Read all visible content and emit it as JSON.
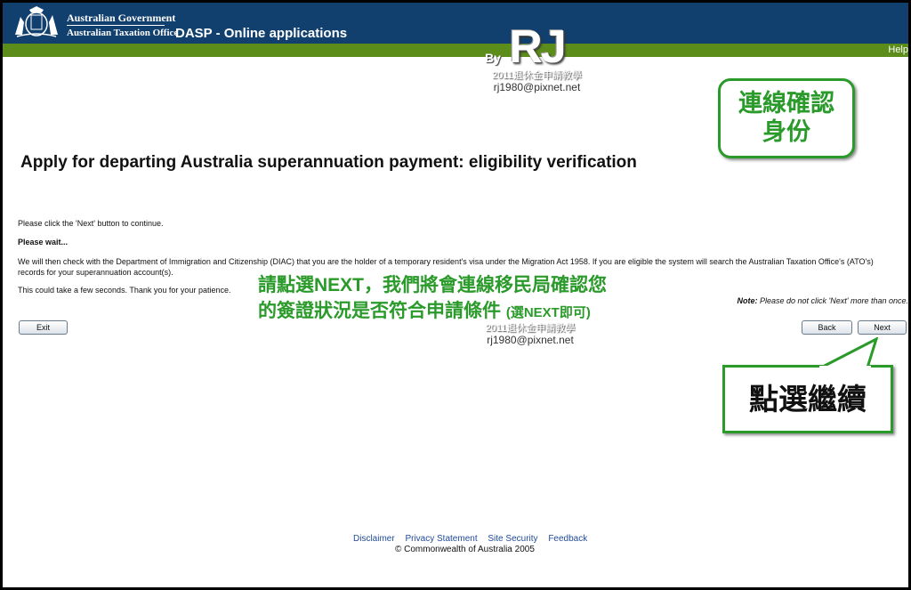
{
  "header": {
    "gov_name": "Australian Government",
    "ato_name": "Australian Taxation Office",
    "app_title": "DASP - Online applications",
    "help_label": "Help"
  },
  "main": {
    "heading": "Apply for departing Australia superannuation payment: eligibility verification",
    "p_continue": "Please click the 'Next' button to continue.",
    "p_wait": "Please wait...",
    "p_check": "We will then check with the Department of Immigration and Citizenship (DIAC) that you are the holder of a temporary resident's visa under the Migration Act 1958. If you are eligible the system will search the Australian Taxation Office's (ATO's) records for your superannuation account(s).",
    "p_time": "This could take a few seconds. Thank you for your patience.",
    "note_label": "Note:",
    "note_text": " Please do not click 'Next' more than once."
  },
  "buttons": {
    "exit": "Exit",
    "back": "Back",
    "next": "Next"
  },
  "footer": {
    "links": [
      "Disclaimer",
      "Privacy Statement",
      "Site Security",
      "Feedback"
    ],
    "copyright": "© Commonwealth of Australia 2005"
  },
  "overlays": {
    "watermark_by": "By",
    "watermark_rj": "RJ",
    "watermark_sub": "2011退休金申請教學",
    "watermark_email": "rj1980@pixnet.net",
    "callout_verify_line1": "連線確認",
    "callout_verify_line2": "身份",
    "instruction_line1": "請點選NEXT，我們將會連線移民局確認您",
    "instruction_line2": "的簽證狀況是否符合申請條件",
    "instruction_small": "(選NEXT即可)",
    "callout_next": "點選繼續"
  },
  "colors": {
    "header_bg": "#11406f",
    "green_bar": "#5c8c1a",
    "callout_green": "#2a9a2a",
    "link_blue": "#1f4a99"
  }
}
